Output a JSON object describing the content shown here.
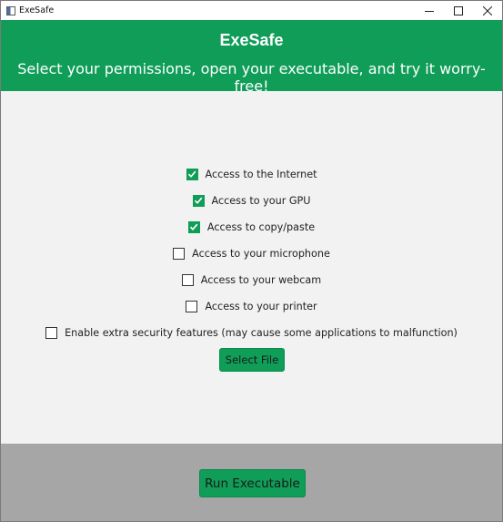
{
  "window": {
    "title": "ExeSafe",
    "controls": [
      "minimize-icon",
      "maximize-icon",
      "close-icon"
    ]
  },
  "header": {
    "title": "ExeSafe",
    "subtitle": "Select your permissions, open your executable, and try it worry-free!",
    "background_color": "#0f9d58"
  },
  "permissions": [
    {
      "label": "Access to the Internet",
      "checked": true
    },
    {
      "label": "Access to your GPU",
      "checked": true
    },
    {
      "label": "Access to copy/paste",
      "checked": true
    },
    {
      "label": "Access to your microphone",
      "checked": false
    },
    {
      "label": "Access to your webcam",
      "checked": false
    },
    {
      "label": "Access to your printer",
      "checked": false
    },
    {
      "label": "Enable extra security features (may cause some applications to malfunction)",
      "checked": false
    }
  ],
  "buttons": {
    "select_file": "Select File",
    "run_executable": "Run Executable"
  },
  "colors": {
    "accent": "#0f9d58",
    "footer_background": "#a6a6a6",
    "body_background": "#f2f2f2"
  }
}
